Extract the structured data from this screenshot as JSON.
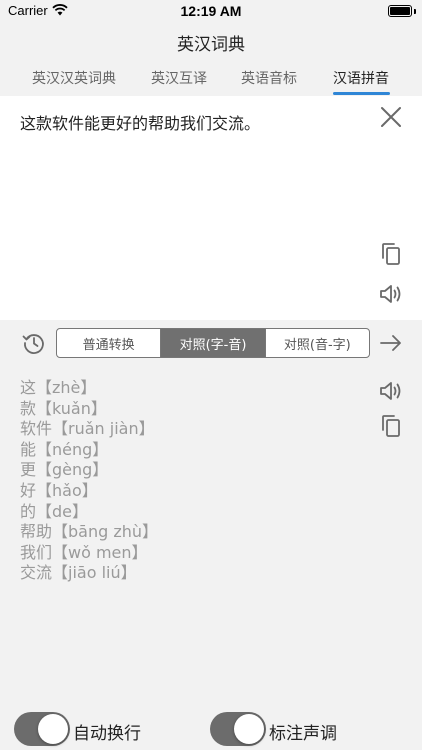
{
  "status_bar": {
    "carrier": "Carrier",
    "time": "12:19 AM"
  },
  "nav": {
    "title": "英汉词典"
  },
  "tabs": [
    {
      "label": "英汉汉英词典",
      "active": false
    },
    {
      "label": "英汉互译",
      "active": false
    },
    {
      "label": "英语音标",
      "active": false
    },
    {
      "label": "汉语拼音",
      "active": true
    }
  ],
  "input": {
    "text": "这款软件能更好的帮助我们交流。"
  },
  "modes": {
    "options": [
      "普通转换",
      "对照(字-音)",
      "对照(音-字)"
    ],
    "selected": "对照(字-音)"
  },
  "result": {
    "lines": [
      "这【zhè】",
      "款【kuǎn】",
      "软件【ruǎn jiàn】",
      "能【néng】",
      "更【gèng】",
      "好【hǎo】",
      "的【de】",
      "帮助【bāng zhù】",
      "我们【wǒ men】",
      "交流【jiāo liú】"
    ]
  },
  "settings": {
    "auto_wrap": {
      "label": "自动换行",
      "on": true
    },
    "mark_tone": {
      "label": "标注声调",
      "on": true
    }
  },
  "colors": {
    "accent": "#2f86d6",
    "toggle_on": "#6c6c6c",
    "segment_selected": "#707070"
  },
  "icons": [
    "wifi-icon",
    "battery-icon",
    "close-icon",
    "copy-icon",
    "speaker-icon",
    "history-icon",
    "arrow-right-icon"
  ]
}
